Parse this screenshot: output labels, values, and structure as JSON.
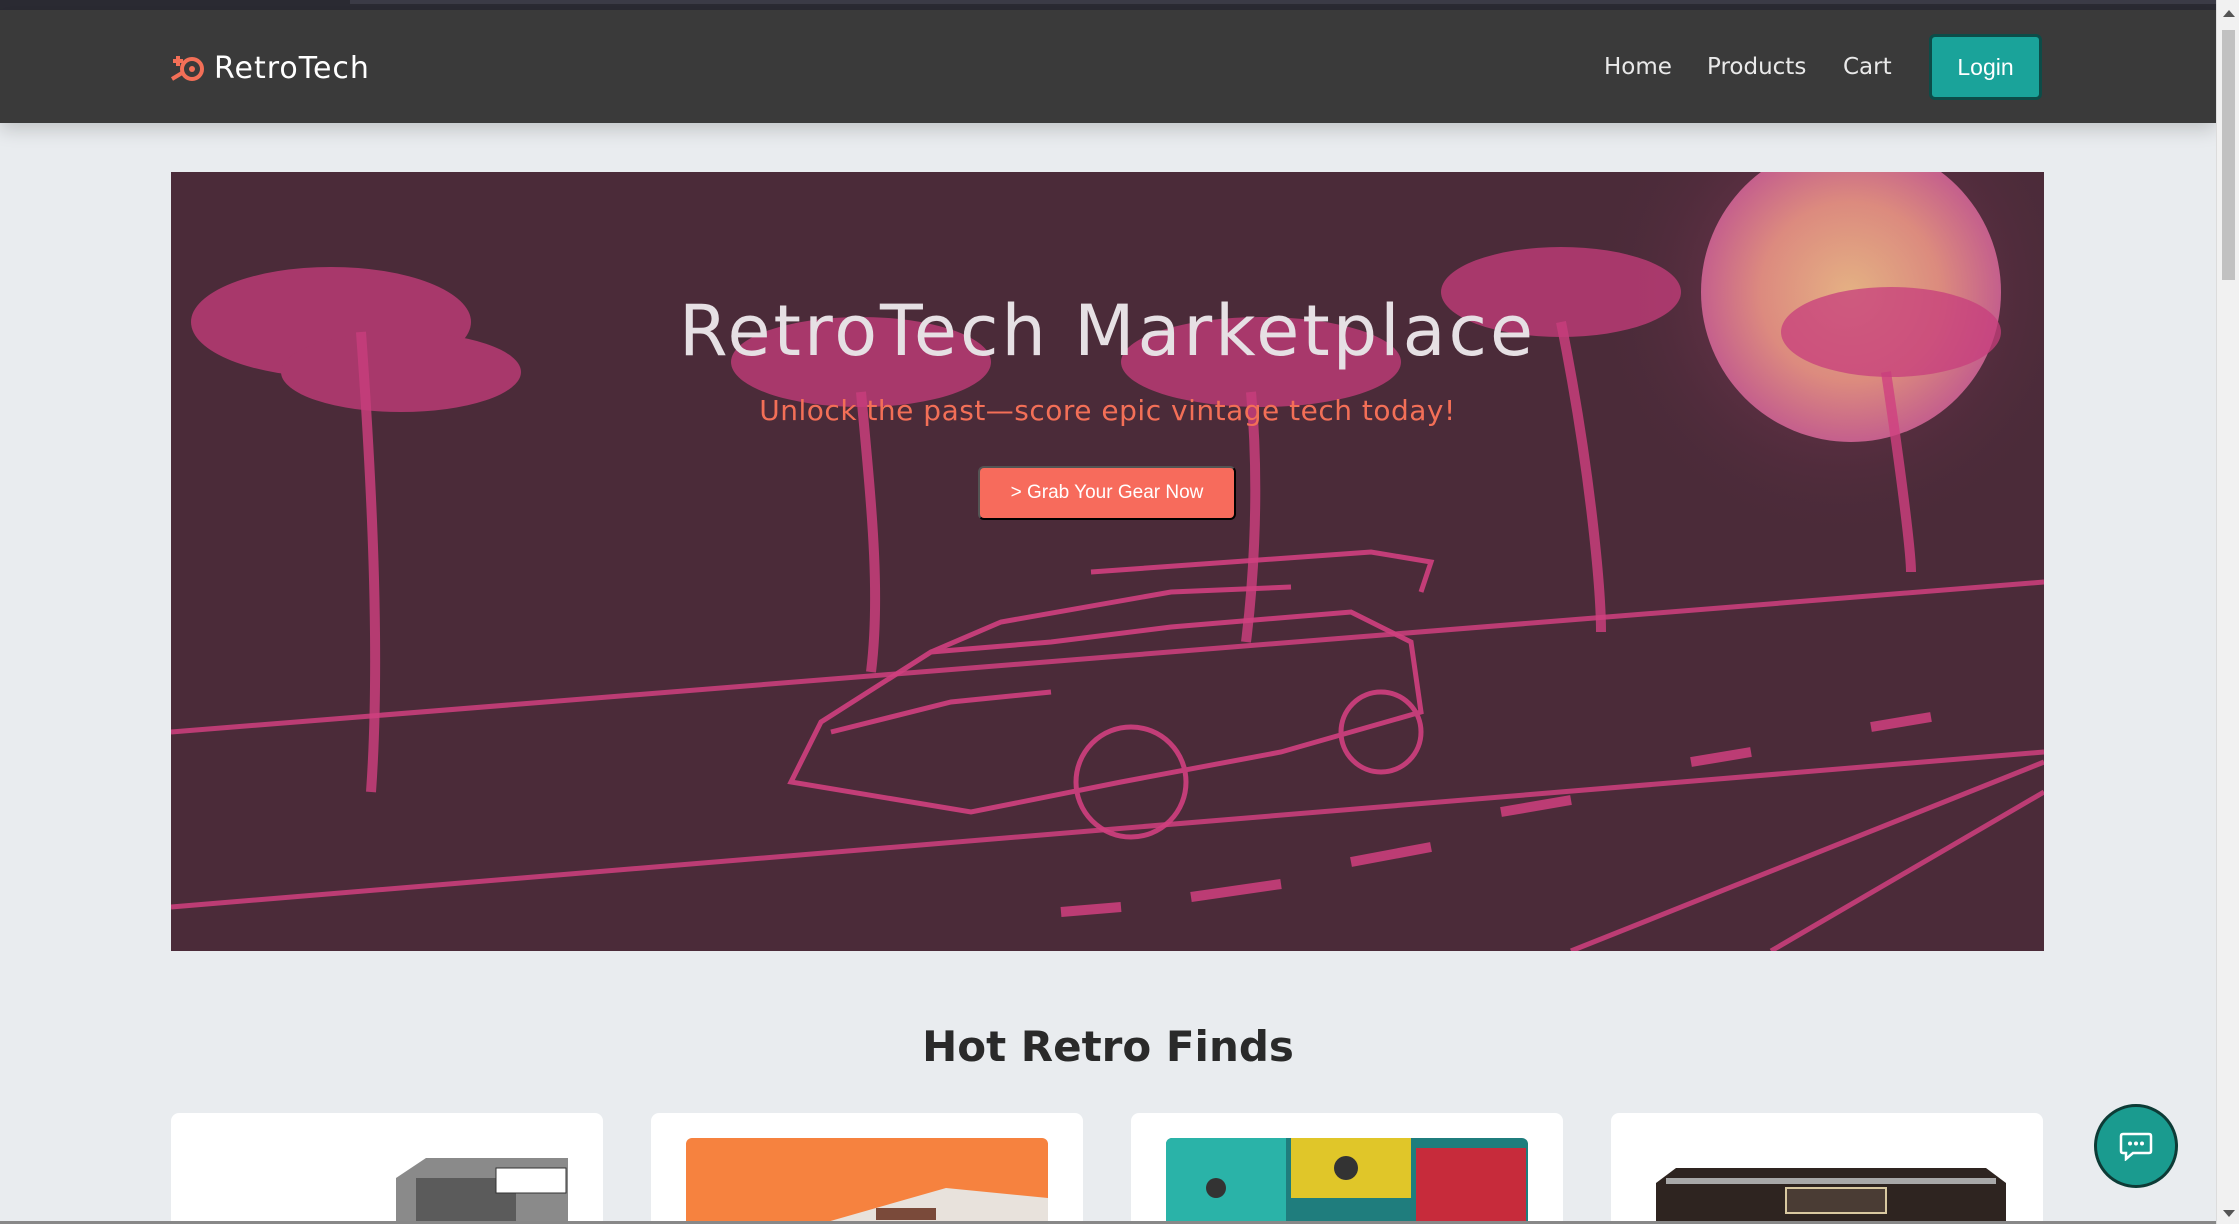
{
  "navbar": {
    "brand": "RetroTech",
    "brand_icon": "gamepad-icon",
    "links": [
      "Home",
      "Products",
      "Cart"
    ],
    "login_label": "Login"
  },
  "hero": {
    "title": "RetroTech Marketplace",
    "subtitle": "Unlock the past—score epic vintage tech today!",
    "button_label": "> Grab Your Gear Now"
  },
  "section": {
    "title": "Hot Retro Finds"
  },
  "colors": {
    "navbar": "#3a3a3a",
    "accent_teal": "#1aa39a",
    "accent_coral": "#f76b5c",
    "hero_bg": "#4a2a38",
    "neon_pink": "#e0408a"
  },
  "chat": {
    "icon": "chat-bubble-icon"
  }
}
